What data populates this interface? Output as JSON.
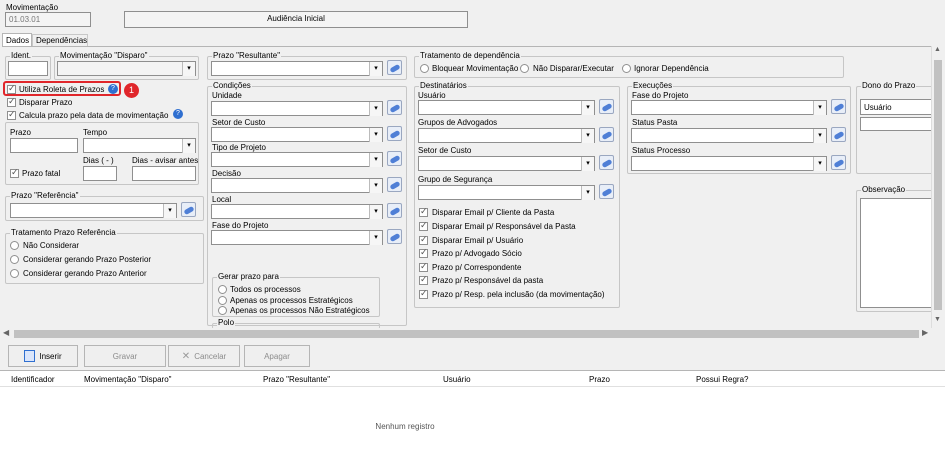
{
  "movimentacao": {
    "label": "Movimentação",
    "code": "01.03.01",
    "description": "Audiência Inicial"
  },
  "tabs": [
    "Dados",
    "Dependências"
  ],
  "ident": {
    "label": "Ident."
  },
  "mov_disparo": {
    "label": "Movimentação \"Disparo\""
  },
  "prazo_resultante": {
    "label": "Prazo \"Resultante\""
  },
  "tratamento_dep": {
    "label": "Tratamento de dependência",
    "options": [
      "Bloquear Movimentação",
      "Não Disparar/Executar",
      "Ignorar Dependência"
    ]
  },
  "checks": {
    "roleta": "Utiliza Roleta de Prazos",
    "disparar": "Disparar Prazo",
    "calcula": "Calcula prazo pela data de movimentação"
  },
  "badge": "1",
  "prazo_group": {
    "prazo": "Prazo",
    "tempo": "Tempo",
    "prazo_fatal": "Prazo fatal",
    "dias": "Dias ( - )",
    "dias_avisar": "Dias - avisar antes"
  },
  "prazo_referencia": {
    "label": "Prazo \"Referência\""
  },
  "tratamento_ref": {
    "label": "Tratamento Prazo Referência",
    "options": [
      "Não Considerar",
      "Considerar gerando Prazo Posterior",
      "Considerar gerando Prazo Anterior"
    ]
  },
  "condicoes": {
    "label": "Condições",
    "fields": [
      "Unidade",
      "Setor de Custo",
      "Tipo de Projeto",
      "Decisão",
      "Local",
      "Fase do Projeto"
    ]
  },
  "gerar": {
    "label": "Gerar prazo para",
    "options": [
      "Todos os processos",
      "Apenas os processos Estratégicos",
      "Apenas os processos Não Estratégicos"
    ]
  },
  "polo": {
    "label": "Polo"
  },
  "destinatarios": {
    "label": "Destinatários",
    "fields": [
      "Usuário",
      "Grupos de Advogados",
      "Setor de Custo",
      "Grupo de Segurança"
    ],
    "checks": [
      "Disparar Email p/ Cliente da Pasta",
      "Disparar Email p/ Responsável da Pasta",
      "Disparar Email p/ Usuário",
      "Prazo p/ Advogado Sócio",
      "Prazo p/ Correspondente",
      "Prazo p/ Responsável da pasta",
      "Prazo p/ Resp. pela inclusão (da movimentação)"
    ]
  },
  "execucoes": {
    "label": "Execuções",
    "fields": [
      "Fase do Projeto",
      "Status Pasta",
      "Status Processo"
    ]
  },
  "dono": {
    "label": "Dono do Prazo",
    "value": "Usuário"
  },
  "observacao": {
    "label": "Observação"
  },
  "buttons": {
    "inserir": "Inserir",
    "gravar": "Gravar",
    "cancelar": "Cancelar",
    "apagar": "Apagar"
  },
  "grid": {
    "columns": [
      "Identificador",
      "Movimentação \"Disparo\"",
      "Prazo \"Resultante\"",
      "Usuário",
      "Prazo",
      "Possui Regra?"
    ],
    "empty": "Nenhum registro"
  },
  "colors": {
    "highlight": "#e0262b",
    "blue_icon": "#2f6fd0"
  }
}
